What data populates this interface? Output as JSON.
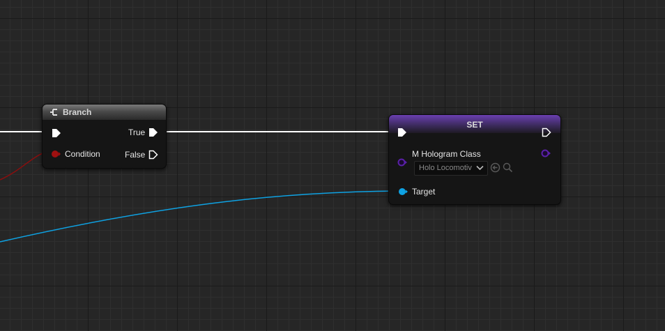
{
  "branch_node": {
    "title": "Branch",
    "inputs": {
      "condition_label": "Condition"
    },
    "outputs": {
      "true_label": "True",
      "false_label": "False"
    }
  },
  "set_node": {
    "title": "SET",
    "variable_label": "M Hologram Class",
    "class_dropdown_value": "Holo Locomotiv",
    "target_label": "Target"
  },
  "colors": {
    "exec_wire": "#ffffff",
    "bool_wire": "#8b0e0e",
    "object_wire": "#0ea2e3",
    "class_pin": "#5a20a8"
  }
}
